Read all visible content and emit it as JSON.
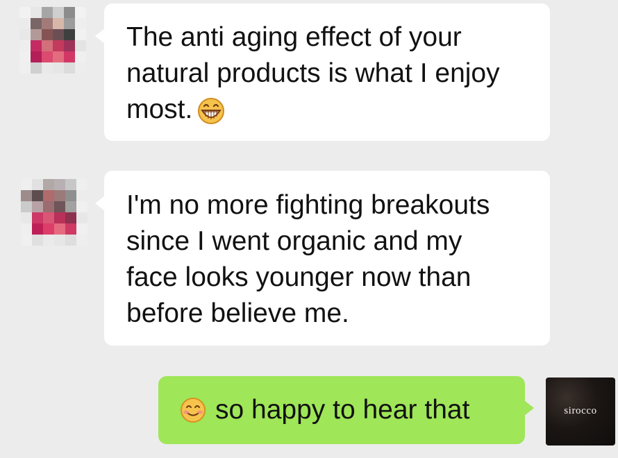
{
  "messages": [
    {
      "sender": "contact",
      "text": "The anti aging effect of your\nnatural products is what I enjoy\nmost.",
      "emoji": "grinning-face-emoji"
    },
    {
      "sender": "contact",
      "text": "I'm no more fighting breakouts\nsince I went organic and my\nface looks younger now than\nbefore believe me."
    },
    {
      "sender": "self",
      "text": "so happy to hear that",
      "emoji": "smiling-face-emoji"
    }
  ],
  "self_avatar": {
    "brand": "sirocco"
  },
  "colors": {
    "background": "#ececec",
    "incoming_bubble": "#ffffff",
    "outgoing_bubble": "#9fe658",
    "text": "#111111"
  }
}
